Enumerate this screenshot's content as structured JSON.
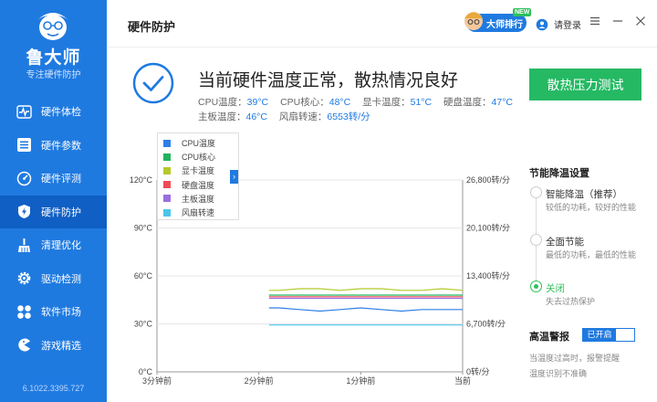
{
  "app": {
    "brand": "鲁大师",
    "brand_sub": "专注硬件防护",
    "version": "6.1022.3395.727"
  },
  "sidebar": {
    "items": [
      {
        "label": "硬件体检",
        "icon": "pulse-icon"
      },
      {
        "label": "硬件参数",
        "icon": "list-icon"
      },
      {
        "label": "硬件评测",
        "icon": "gauge-icon"
      },
      {
        "label": "硬件防护",
        "icon": "lightning-shield-icon",
        "active": true
      },
      {
        "label": "清理优化",
        "icon": "broom-icon"
      },
      {
        "label": "驱动检测",
        "icon": "gear-icon"
      },
      {
        "label": "软件市场",
        "icon": "apps-icon"
      },
      {
        "label": "游戏精选",
        "icon": "pacman-icon"
      }
    ]
  },
  "header": {
    "title": "硬件防护",
    "rank_label": "大师排行",
    "new_badge": "NEW",
    "login_label": "请登录"
  },
  "status": {
    "title": "当前硬件温度正常，散热情况良好",
    "cpu_temp_label": "CPU温度：",
    "cpu_temp_value": "39°C",
    "cpu_core_label": "CPU核心：",
    "cpu_core_value": "48°C",
    "gpu_temp_label": "显卡温度：",
    "gpu_temp_value": "51°C",
    "disk_temp_label": "硬盘温度：",
    "disk_temp_value": "47°C",
    "board_temp_label": "主板温度：",
    "board_temp_value": "46°C",
    "fan_label": "风扇转速：",
    "fan_value": "6553转/分",
    "stress_button": "散热压力测试"
  },
  "chart_data": {
    "type": "line",
    "x_tick_labels": [
      "3分钟前",
      "2分钟前",
      "1分钟前",
      "当前"
    ],
    "y_left_ticks": [
      "0°C",
      "30°C",
      "60°C",
      "90°C",
      "120°C"
    ],
    "y_right_ticks": [
      "0转/分",
      "6,700转/分",
      "13,400转/分",
      "20,100转/分",
      "26,800转/分"
    ],
    "ylim_left": [
      0,
      120
    ],
    "ylim_right": [
      0,
      26800
    ],
    "grid": true,
    "legend_position": "top-left",
    "x": [
      0,
      0.2,
      0.4,
      0.6,
      0.8,
      1.0,
      1.2,
      1.4,
      1.6,
      1.8,
      2.0,
      2.2,
      2.4,
      2.6,
      2.8,
      3.0
    ],
    "x_start": 1.1,
    "series": [
      {
        "name": "CPU温度",
        "color": "#2e7fe6",
        "axis": "left",
        "values": [
          39,
          38,
          40,
          39,
          38,
          39,
          40,
          39,
          38,
          39,
          40,
          39,
          38,
          39,
          39,
          39
        ]
      },
      {
        "name": "CPU核心",
        "color": "#22b35e",
        "axis": "left",
        "values": [
          48,
          48,
          48,
          49,
          48,
          48,
          48,
          48,
          48,
          48,
          48,
          48,
          48,
          48,
          48,
          48
        ]
      },
      {
        "name": "显卡温度",
        "color": "#b5c82a",
        "axis": "left",
        "values": [
          52,
          52,
          51,
          52,
          53,
          52,
          51,
          52,
          52,
          51,
          52,
          52,
          51,
          51,
          52,
          51
        ]
      },
      {
        "name": "硬盘温度",
        "color": "#ef4b57",
        "axis": "left",
        "values": [
          47,
          47,
          47,
          47,
          47,
          47,
          47,
          47,
          47,
          47,
          47,
          47,
          47,
          47,
          47,
          47
        ]
      },
      {
        "name": "主板温度",
        "color": "#9b6fe0",
        "axis": "left",
        "values": [
          46,
          46,
          46,
          46,
          46,
          46,
          46,
          46,
          46,
          46,
          46,
          46,
          46,
          46,
          46,
          46
        ]
      },
      {
        "name": "风扇转速",
        "color": "#4cc6ea",
        "axis": "right",
        "values": [
          6553,
          6553,
          6553,
          6553,
          6553,
          6553,
          6553,
          6553,
          6553,
          6553,
          6553,
          6553,
          6553,
          6553,
          6553,
          6553
        ]
      }
    ]
  },
  "settings": {
    "title": "节能降温设置",
    "options": [
      {
        "label": "智能降温（推荐）",
        "desc": "较低的功耗，较好的性能",
        "selected": false
      },
      {
        "label": "全面节能",
        "desc": "最低的功耗，最低的性能",
        "selected": false
      },
      {
        "label": "关闭",
        "desc": "失去过热保护",
        "selected": true
      }
    ]
  },
  "alert": {
    "title": "高温警报",
    "toggle_label": "已开启",
    "desc1": "当温度过高时，报警提醒",
    "desc2": "温度识别不准确"
  },
  "colors": {
    "brand_blue": "#1f7ae0",
    "accent_green": "#25b963"
  }
}
